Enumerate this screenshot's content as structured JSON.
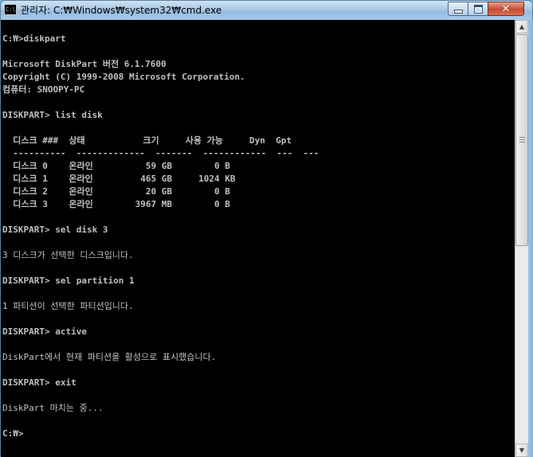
{
  "window": {
    "title": "관리자: C:₩Windows₩system32₩cmd.exe",
    "icon": "cmd-icon",
    "controls": {
      "minimize": "minimize-icon",
      "maximize": "maximize-icon",
      "close": "close-icon"
    }
  },
  "console": {
    "lines": [
      "C:₩>diskpart",
      "",
      "Microsoft DiskPart 버전 6.1.7600",
      "Copyright (C) 1999-2008 Microsoft Corporation.",
      "컴퓨터: SNOOPY-PC",
      "",
      "DISKPART> list disk",
      "",
      "  디스크 ###  상태           크기     사용 가능     Dyn  Gpt",
      "  ----------  -------------  -------  ------------  ---  ---",
      "  디스크 0    온라인          59 GB        0 B",
      "  디스크 1    온라인         465 GB     1024 KB",
      "  디스크 2    온라인          20 GB        0 B",
      "  디스크 3    온라인        3967 MB        0 B",
      "",
      "DISKPART> sel disk 3",
      "",
      "3 디스크가 선택한 디스크입니다.",
      "",
      "DISKPART> sel partition 1",
      "",
      "1 파티션이 선택한 파티션입니다.",
      "",
      "DISKPART> active",
      "",
      "DiskPart에서 현재 파티션을 활성으로 표시했습니다.",
      "",
      "DISKPART> exit",
      "",
      "DiskPart 마치는 중...",
      "",
      "C:₩>"
    ]
  },
  "scrollbar": {
    "up": "scroll-up-arrow-icon",
    "down": "scroll-down-arrow-icon"
  }
}
